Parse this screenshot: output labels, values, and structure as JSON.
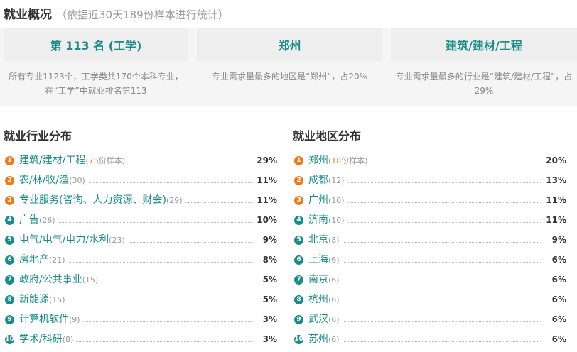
{
  "header": {
    "title": "就业概况",
    "subtitle": "（依据近30天189份样本进行统计）"
  },
  "summary": [
    {
      "headline": "第 113 名 (工学)",
      "description": "所有专业1123个，工学类共170个本科专业，在“工学”中就业排名第113"
    },
    {
      "headline": "郑州",
      "description": "专业需求量最多的地区是“郑州”，占20%"
    },
    {
      "headline": "建筑/建材/工程",
      "description": "专业需求量最多的行业是“建筑/建材/工程”，占29%"
    }
  ],
  "industry": {
    "title": "就业行业分布",
    "items": [
      {
        "rank": "1",
        "name": "建筑/建材/工程",
        "count": "75",
        "count_suffix": "份样本",
        "percent": "29%"
      },
      {
        "rank": "2",
        "name": "农/林/牧/渔",
        "count": "30",
        "percent": "11%"
      },
      {
        "rank": "3",
        "name": "专业服务(咨询、人力资源、财会)",
        "count": "29",
        "percent": "11%"
      },
      {
        "rank": "4",
        "name": "广告",
        "count": "26",
        "percent": "10%"
      },
      {
        "rank": "5",
        "name": "电气/电气/电力/水利",
        "count": "23",
        "percent": "9%"
      },
      {
        "rank": "6",
        "name": "房地产",
        "count": "21",
        "percent": "8%"
      },
      {
        "rank": "7",
        "name": "政府/公共事业",
        "count": "15",
        "percent": "5%"
      },
      {
        "rank": "8",
        "name": "新能源",
        "count": "15",
        "percent": "5%"
      },
      {
        "rank": "9",
        "name": "计算机软件",
        "count": "9",
        "percent": "3%"
      },
      {
        "rank": "10",
        "name": "学术/科研",
        "count": "8",
        "percent": "3%"
      }
    ]
  },
  "region": {
    "title": "就业地区分布",
    "items": [
      {
        "rank": "1",
        "name": "郑州",
        "count": "18",
        "count_suffix": "份样本",
        "percent": "20%"
      },
      {
        "rank": "2",
        "name": "成都",
        "count": "12",
        "percent": "13%"
      },
      {
        "rank": "3",
        "name": "广州",
        "count": "10",
        "percent": "11%"
      },
      {
        "rank": "4",
        "name": "济南",
        "count": "10",
        "percent": "11%"
      },
      {
        "rank": "5",
        "name": "北京",
        "count": "8",
        "percent": "9%"
      },
      {
        "rank": "6",
        "name": "上海",
        "count": "6",
        "percent": "6%"
      },
      {
        "rank": "7",
        "name": "南京",
        "count": "6",
        "percent": "6%"
      },
      {
        "rank": "8",
        "name": "杭州",
        "count": "6",
        "percent": "6%"
      },
      {
        "rank": "9",
        "name": "武汉",
        "count": "6",
        "percent": "6%"
      },
      {
        "rank": "10",
        "name": "苏州",
        "count": "6",
        "percent": "6%"
      }
    ]
  },
  "colors": {
    "accent": "#1a8c8a",
    "top_badge": "#f07a1a",
    "rest_badge": "#1a8c8a"
  }
}
